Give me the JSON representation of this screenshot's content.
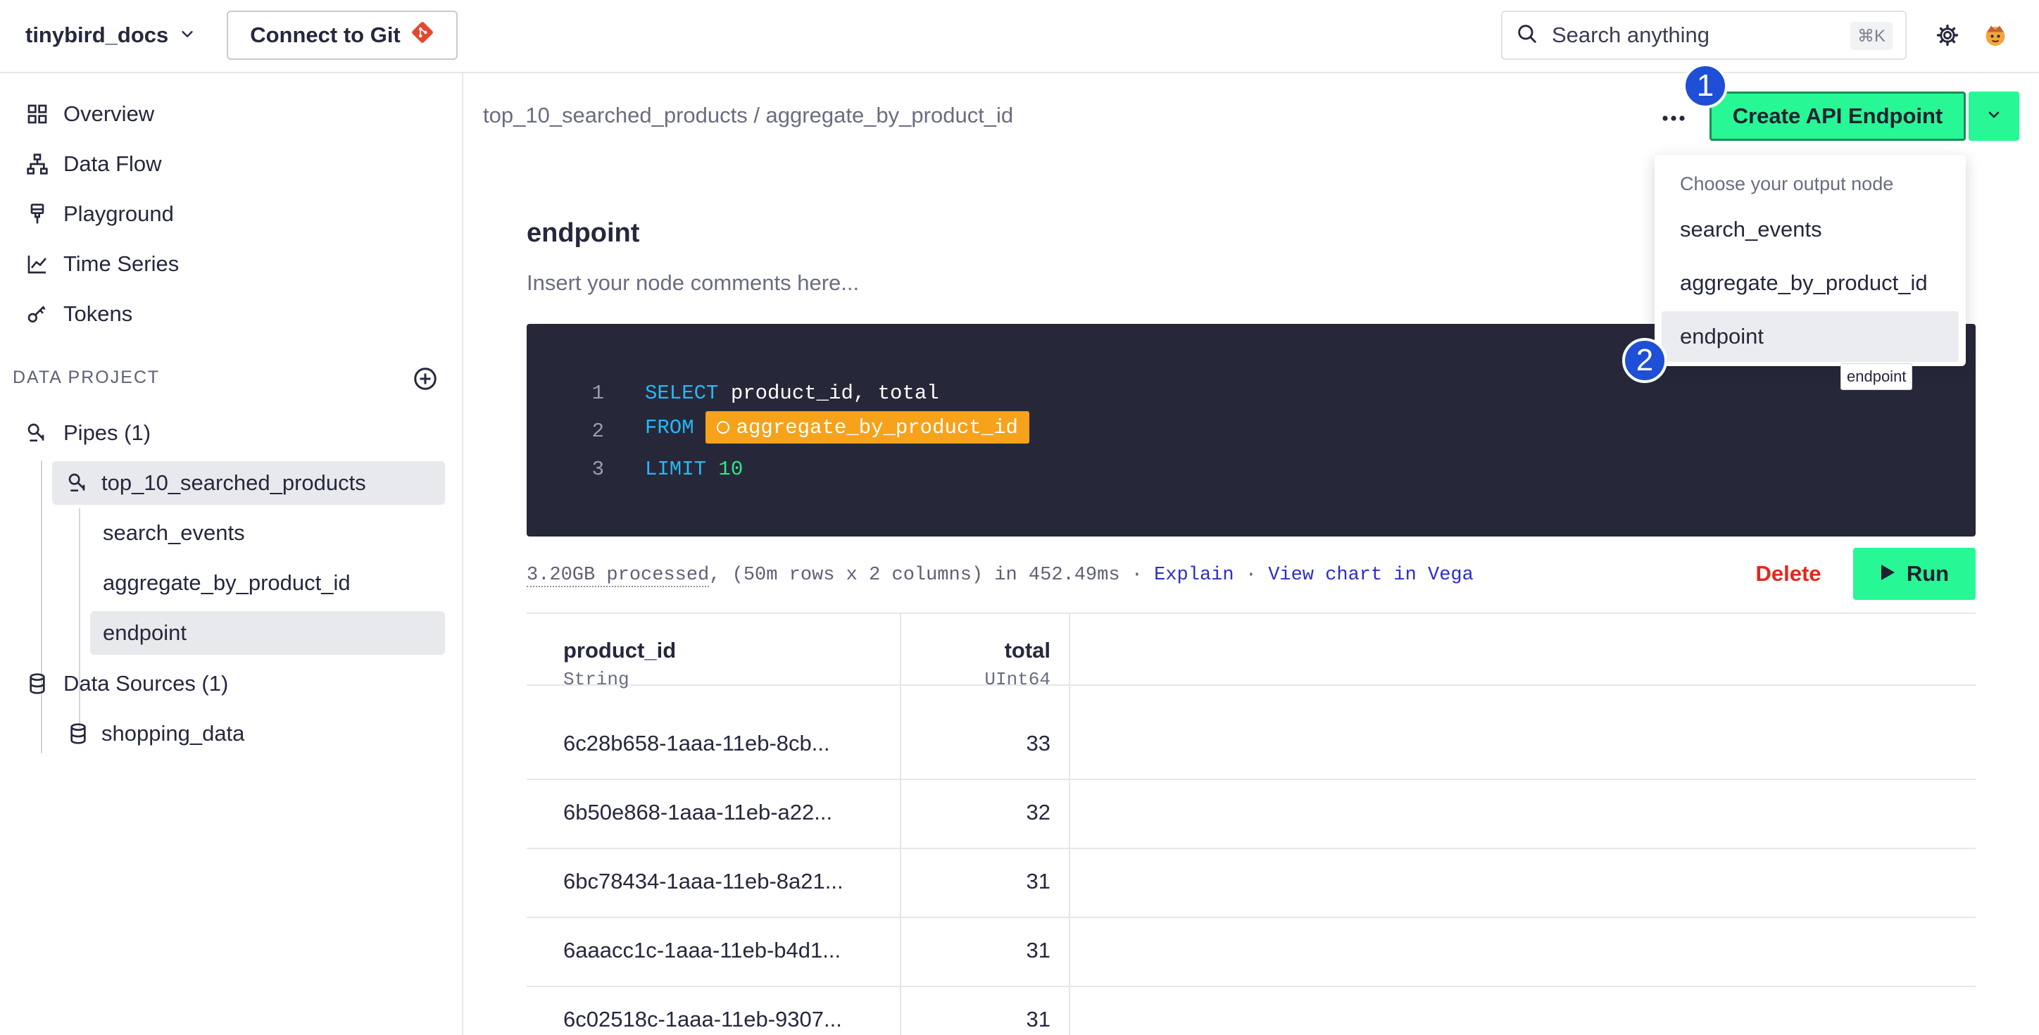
{
  "workspace": {
    "name": "tinybird_docs"
  },
  "topbar": {
    "git_button_label": "Connect to Git",
    "search_placeholder": "Search anything",
    "search_shortcut": "⌘K"
  },
  "sidebar": {
    "nav": [
      {
        "label": "Overview",
        "icon": "grid-icon"
      },
      {
        "label": "Data Flow",
        "icon": "flow-icon"
      },
      {
        "label": "Playground",
        "icon": "brush-icon"
      },
      {
        "label": "Time Series",
        "icon": "line-chart-icon"
      },
      {
        "label": "Tokens",
        "icon": "key-icon"
      }
    ],
    "section_label": "DATA PROJECT",
    "pipes_label": "Pipes (1)",
    "pipe": {
      "name": "top_10_searched_products",
      "nodes": [
        "search_events",
        "aggregate_by_product_id",
        "endpoint"
      ]
    },
    "datasources_label": "Data Sources (1)",
    "datasource": "shopping_data"
  },
  "main": {
    "breadcrumb": "top_10_searched_products / aggregate_by_product_id",
    "create_label": "Create API Endpoint",
    "node_title": "endpoint",
    "node_desc": "Insert your node comments here...",
    "code": {
      "line_numbers": [
        "1",
        "2",
        "3"
      ],
      "l1_kw": "SELECT",
      "l1_rest": " product_id, total",
      "l2_kw": "FROM",
      "l2_ref": "aggregate_by_product_id",
      "l3_kw": "LIMIT",
      "l3_num": " 10"
    },
    "stats": {
      "processed": "3.20GB processed",
      "details": ", (50m rows x 2 columns) in 452.49ms · ",
      "explain": "Explain",
      "sep": " · ",
      "vega": "View chart in Vega"
    },
    "delete_label": "Delete",
    "run_label": "Run",
    "table": {
      "columns": [
        {
          "name": "product_id",
          "type": "String"
        },
        {
          "name": "total",
          "type": "UInt64"
        }
      ],
      "rows": [
        [
          "6c28b658-1aaa-11eb-8cb...",
          "33"
        ],
        [
          "6b50e868-1aaa-11eb-a22...",
          "32"
        ],
        [
          "6bc78434-1aaa-11eb-8a21...",
          "31"
        ],
        [
          "6aaacc1c-1aaa-11eb-b4d1...",
          "31"
        ],
        [
          "6c02518c-1aaa-11eb-9307...",
          "31"
        ]
      ]
    }
  },
  "dropdown": {
    "label": "Choose your output node",
    "items": [
      "search_events",
      "aggregate_by_product_id",
      "endpoint"
    ],
    "tooltip": "endpoint"
  },
  "steps": [
    "1",
    "2"
  ],
  "colors": {
    "accent_green": "#27f795",
    "editor_bg": "#262839",
    "node_ref": "#f7a21b",
    "delete_red": "#e2281d",
    "step_blue": "#1f4fd6"
  }
}
